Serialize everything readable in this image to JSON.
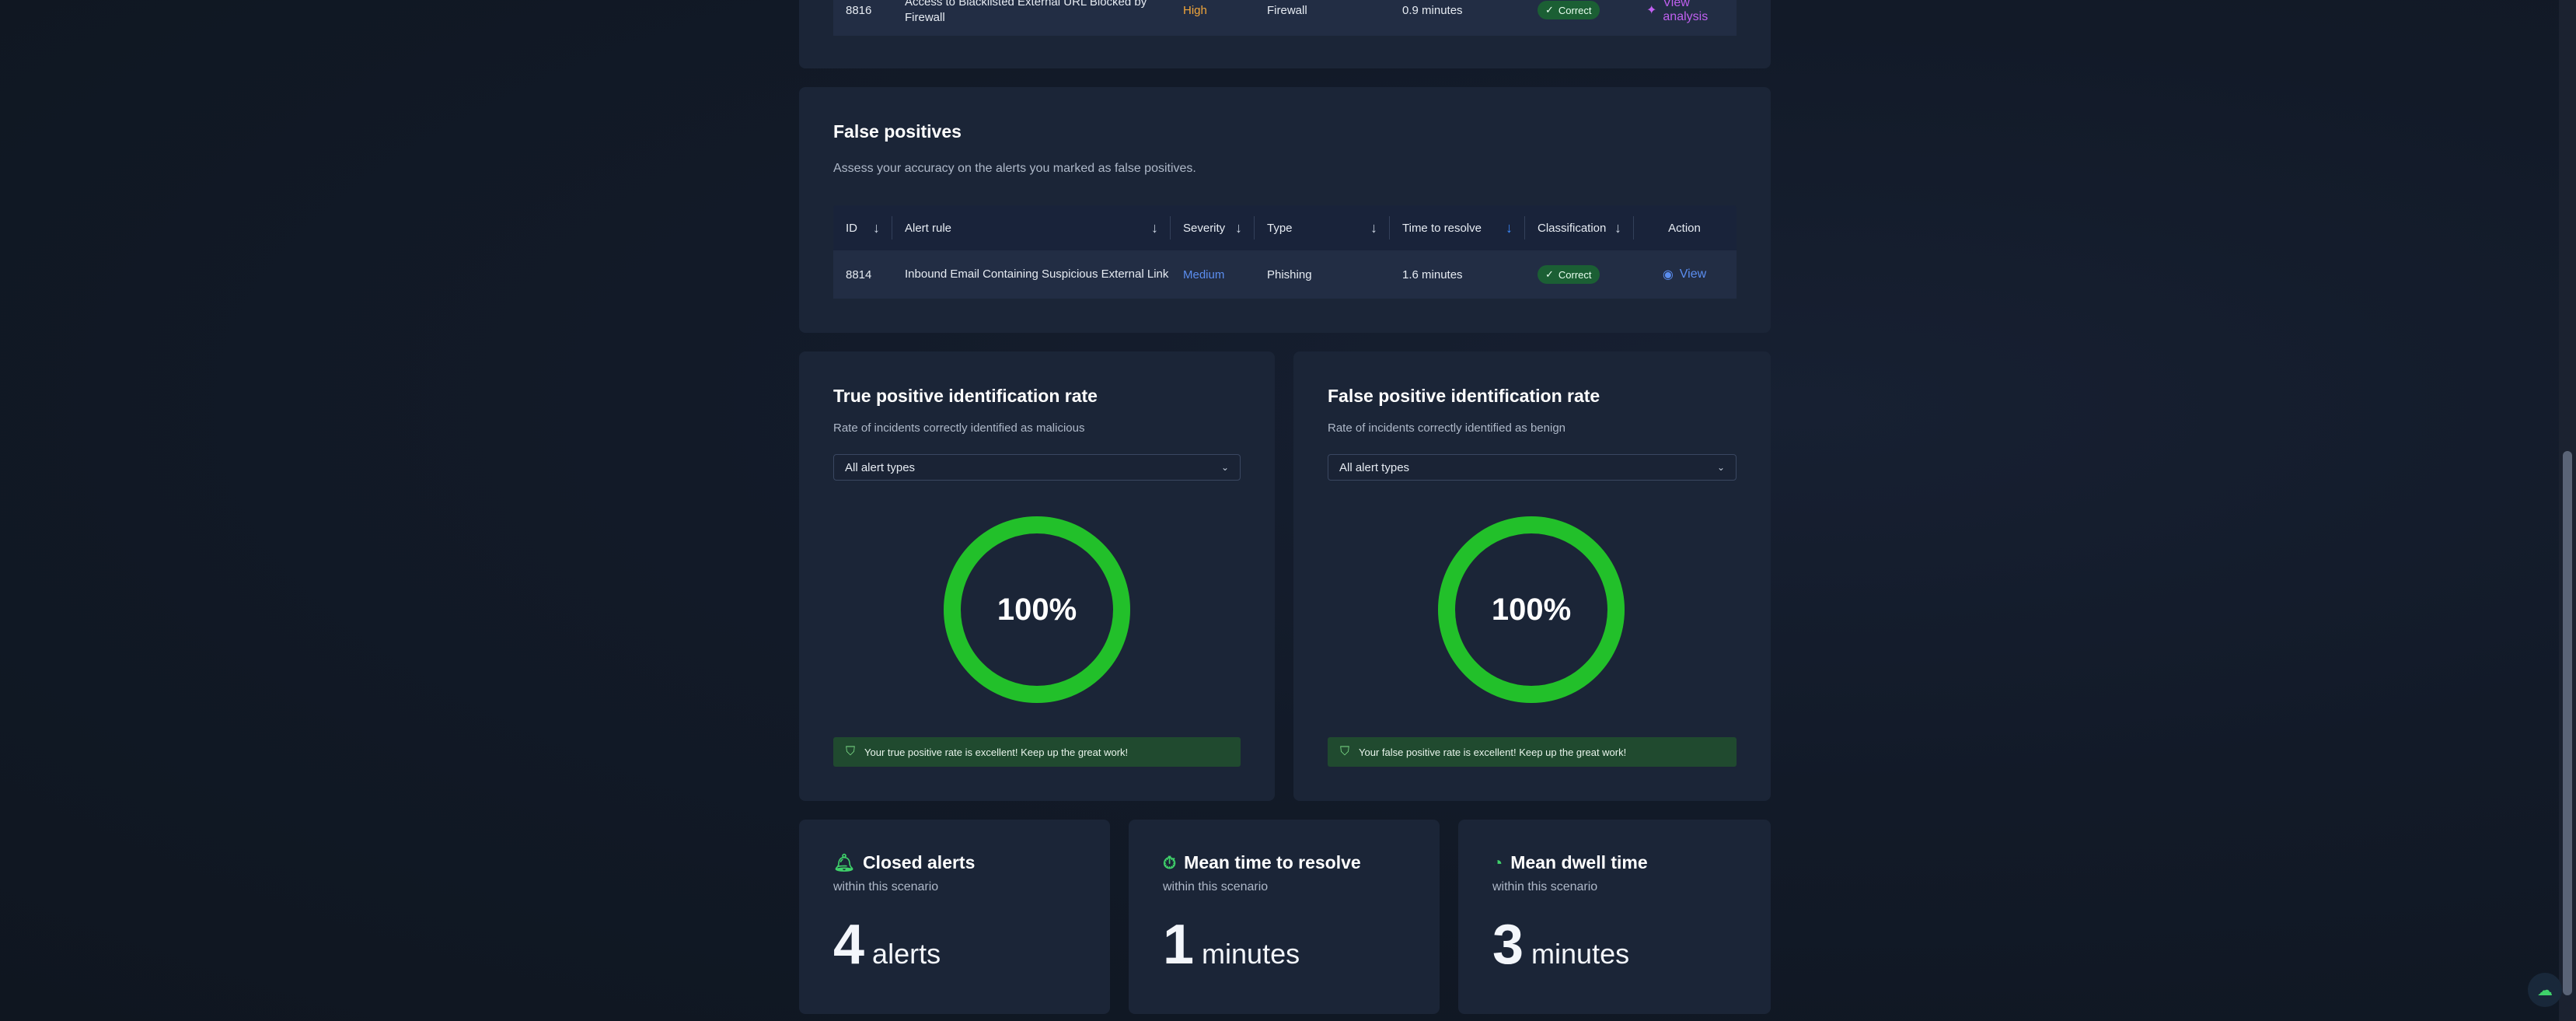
{
  "top_row": {
    "id": "8816",
    "alert_rule": "Access to Blacklisted External URL Blocked by Firewall",
    "severity": "High",
    "type": "Firewall",
    "time_to_resolve": "0.9 minutes",
    "classification": "Correct",
    "action": "View analysis"
  },
  "false_positives": {
    "title": "False positives",
    "description": "Assess your accuracy on the alerts you marked as false positives.",
    "columns": [
      "ID",
      "Alert rule",
      "Severity",
      "Type",
      "Time to resolve",
      "Classification",
      "Action"
    ],
    "rows": [
      {
        "id": "8814",
        "alert_rule": "Inbound Email Containing Suspicious External Link",
        "severity": "Medium",
        "type": "Phishing",
        "time_to_resolve": "1.6 minutes",
        "classification": "Correct",
        "action": "View"
      }
    ]
  },
  "tp_rate": {
    "title": "True positive identification rate",
    "subtitle": "Rate of incidents correctly identified as malicious",
    "select_value": "All alert types",
    "value_label": "100%",
    "value": 1.0,
    "banner": "Your true positive rate is excellent! Keep up the great work!"
  },
  "fp_rate": {
    "title": "False positive identification rate",
    "subtitle": "Rate of incidents correctly identified as benign",
    "select_value": "All alert types",
    "value_label": "100%",
    "value": 1.0,
    "banner": "Your false positive rate is excellent! Keep up the great work!"
  },
  "stats": {
    "closed": {
      "title": "Closed alerts",
      "subtitle": "within this scenario",
      "value": "4",
      "unit": "alerts"
    },
    "mttr": {
      "title": "Mean time to resolve",
      "subtitle": "within this scenario",
      "value": "1",
      "unit": "minutes"
    },
    "dwell": {
      "title": "Mean dwell time",
      "subtitle": "within this scenario",
      "value": "3",
      "unit": "minutes"
    }
  },
  "colors": {
    "high": "#f0a53a",
    "medium": "#5b8def",
    "success": "#22c02a",
    "link": "#c060f0"
  }
}
